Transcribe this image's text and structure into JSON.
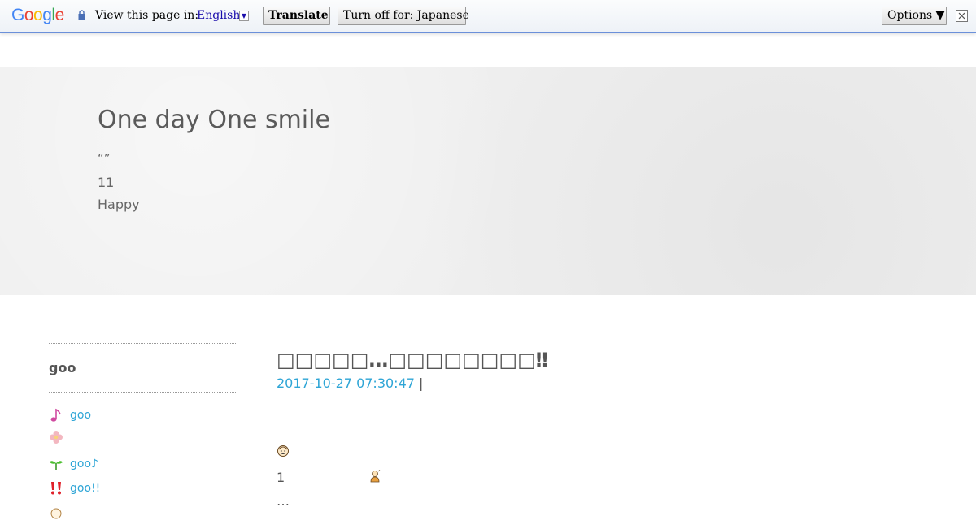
{
  "translate_bar": {
    "logo_letters": [
      {
        "char": "G",
        "color": "#4285f4"
      },
      {
        "char": "o",
        "color": "#ea4335"
      },
      {
        "char": "o",
        "color": "#fbbc05"
      },
      {
        "char": "g",
        "color": "#4285f4"
      },
      {
        "char": "l",
        "color": "#34a853"
      },
      {
        "char": "e",
        "color": "#ea4335"
      }
    ],
    "prompt": "View this page in:",
    "language": "English",
    "translate_label": "Translate",
    "turn_off_label": "Turn off for: Japanese",
    "options_label": "Options ▼"
  },
  "header": {
    "title": "One day One smile",
    "quote": "“”",
    "line1": "11",
    "line2": "Happy"
  },
  "sidebar": {
    "heading": "goo",
    "items": [
      {
        "icon": "music-note-icon",
        "label": "goo"
      },
      {
        "icon": "flower-icon",
        "label": ""
      },
      {
        "icon": "sprout-icon",
        "label": "goo♪"
      },
      {
        "icon": "double-exclamation-icon",
        "label": "goo!!"
      },
      {
        "icon": "face-icon",
        "label": ""
      }
    ]
  },
  "article": {
    "title": "□□□□□…□□□□□□□□‼",
    "date": "2017-10-27 07:30:47",
    "separator": " |",
    "line1": "1",
    "line2": "…"
  },
  "colors": {
    "link": "#2ea5d6",
    "header_bg": "#efefef",
    "text": "#555555"
  }
}
